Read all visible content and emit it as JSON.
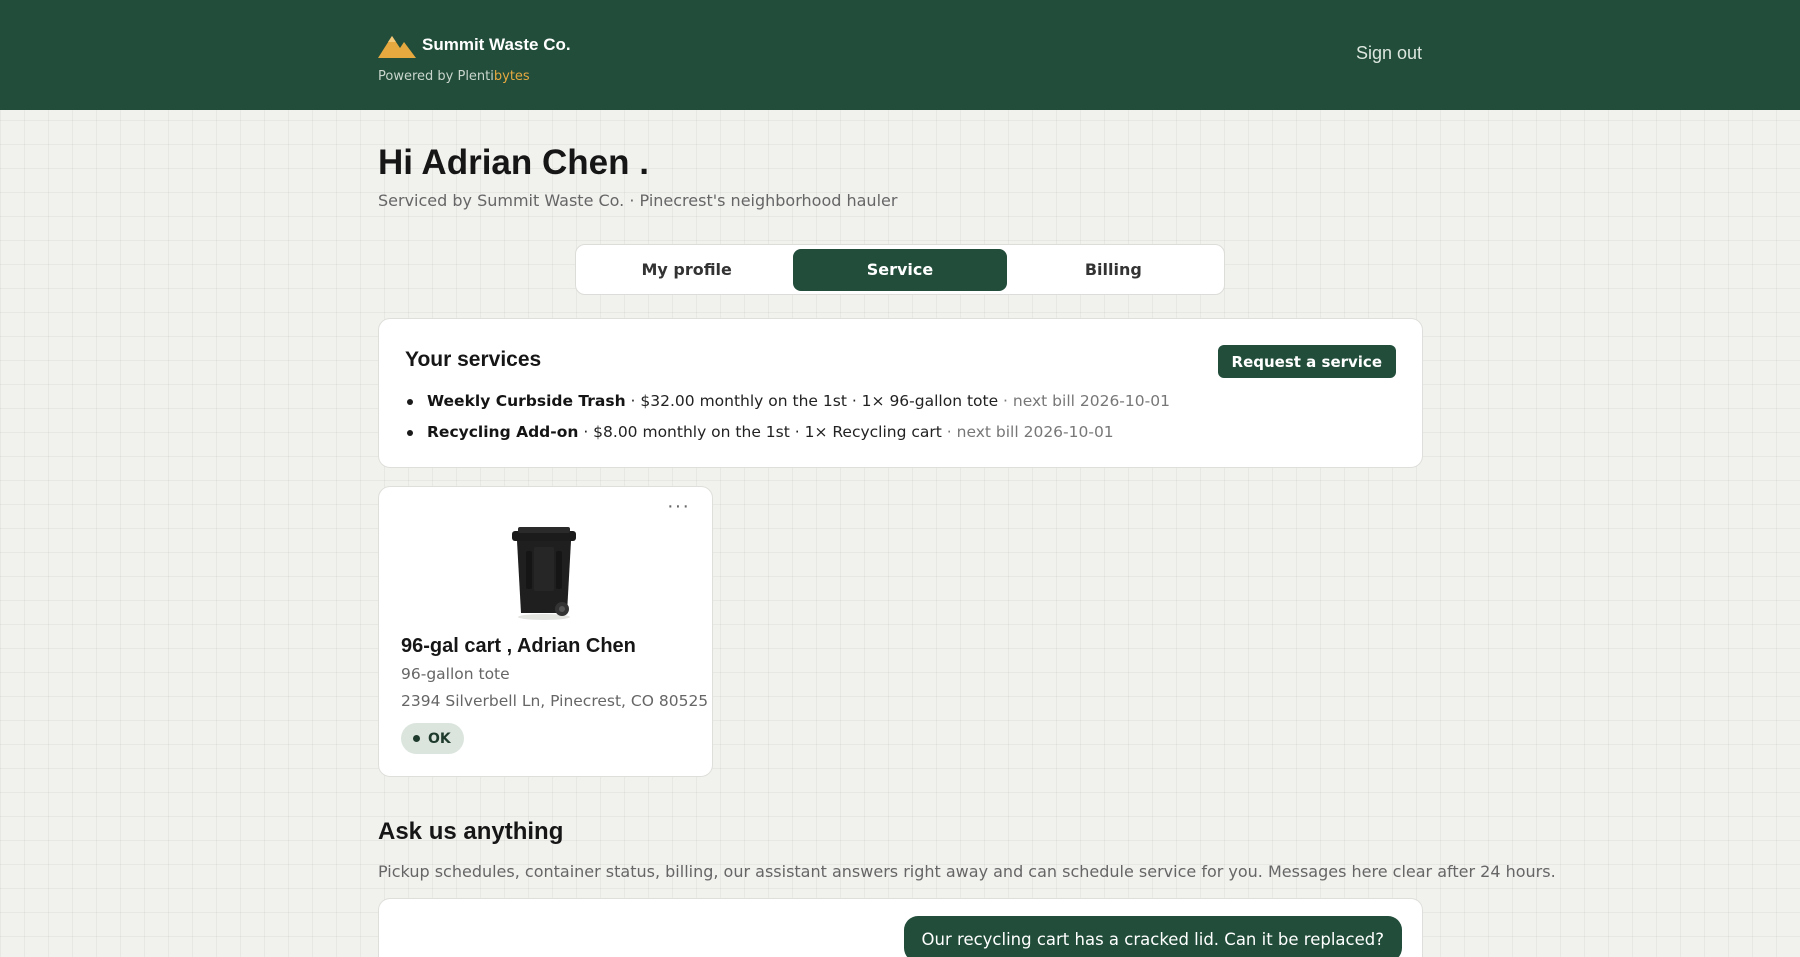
{
  "header": {
    "brand_name": "Summit Waste Co.",
    "powered_prefix": "Powered by Plenti",
    "powered_highlight": "bytes",
    "signout_label": "Sign out"
  },
  "page": {
    "greeting": "Hi Adrian Chen .",
    "subtitle": "Serviced by Summit Waste Co. · Pinecrest's neighborhood hauler"
  },
  "tabs": [
    {
      "label": "My profile",
      "active": false
    },
    {
      "label": "Service",
      "active": true
    },
    {
      "label": "Billing",
      "active": false
    }
  ],
  "services": {
    "title": "Your services",
    "request_label": "Request a service",
    "items": [
      {
        "name": "Weekly Curbside Trash",
        "detail": " · $32.00 monthly on the 1st · 1× 96-gallon tote",
        "next": " · next bill 2026-10-01"
      },
      {
        "name": "Recycling Add-on",
        "detail": " · $8.00 monthly on the 1st · 1× Recycling cart",
        "next": " · next bill 2026-10-01"
      }
    ]
  },
  "cart": {
    "menu_label": "···",
    "title": "96-gal cart ,  Adrian Chen",
    "type": "96-gallon tote",
    "address": "2394 Silverbell Ln, Pinecrest, CO 80525",
    "status": "OK"
  },
  "ask": {
    "title": "Ask us anything",
    "description": "Pickup schedules, container status, billing, our assistant answers right away and can schedule service for you. Messages here clear after 24 hours.",
    "messages": [
      {
        "from": "user",
        "text": "Our recycling cart has a cracked lid. Can it be replaced?"
      }
    ]
  },
  "colors": {
    "brand": "#214d3a",
    "accent": "#e6a940",
    "background": "#f1f2ee"
  },
  "icons": {
    "logo": "mountain-logo-icon",
    "cart": "trash-cart-icon"
  }
}
